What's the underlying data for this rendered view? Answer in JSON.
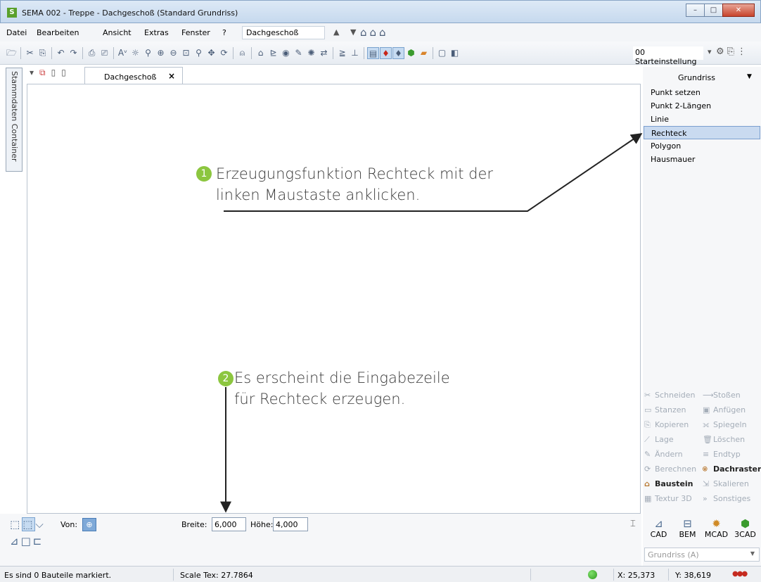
{
  "window": {
    "app_icon_letter": "S",
    "title": "SEMA  002 - Treppe  - Dachgeschoß (Standard Grundriss)",
    "minimize": "–",
    "maximize": "□",
    "close": "✕"
  },
  "menu": {
    "items": [
      "Datei",
      "Bearbeiten",
      "Ansicht",
      "Extras",
      "Fenster",
      "?"
    ],
    "mnemonics": [
      "D",
      "B",
      "A",
      "x",
      "F",
      "?"
    ],
    "layer_select": "Dachgeschoß",
    "nav_arrows": "▲ ▼"
  },
  "toolbar": {
    "preset_select": "00 Starteinstellung"
  },
  "side_tab": {
    "label": "Stammdaten Container"
  },
  "document": {
    "tab_label": "Dachgeschoß",
    "tab_close": "×"
  },
  "right_panel": {
    "title": "Grundriss",
    "title_arrow": "▼",
    "items": [
      "Punkt setzen",
      "Punkt 2-Längen",
      "Linie",
      "Rechteck",
      "Polygon",
      "Hausmauer"
    ],
    "selected_index": 3,
    "tools": [
      [
        "Schneiden",
        "Stoßen"
      ],
      [
        "Stanzen",
        "Anfügen"
      ],
      [
        "Kopieren",
        "Spiegeln"
      ],
      [
        "Lage",
        "Löschen"
      ],
      [
        "Ändern",
        "Endtyp"
      ],
      [
        "Berechnen",
        "Dachraster"
      ],
      [
        "Baustein",
        "Skalieren"
      ],
      [
        "Textur 3D",
        "Sonstiges"
      ]
    ],
    "modules": [
      "CAD",
      "BEM",
      "MCAD",
      "3CAD"
    ],
    "view_select": "Grundriss (A)"
  },
  "input_line": {
    "von_label": "Von:",
    "breite_label": "Breite:",
    "breite_value": "6,000",
    "hoehe_label": "Höhe:",
    "hoehe_value": "4,000"
  },
  "status": {
    "message": "Es sind 0 Bauteile markiert.",
    "scale": "Scale Tex: 27.7864",
    "x": "X: 25,373",
    "y": "Y: 38,619"
  },
  "annotations": [
    {
      "number": "1",
      "line1": "Erzeugungsfunktion Rechteck mit der",
      "line2": "linken Maustaste anklicken."
    },
    {
      "number": "2",
      "line1": "Es erscheint die Eingabezeile",
      "line2": "für Rechteck erzeugen."
    }
  ],
  "colors": {
    "badge": "#8cc63f",
    "selection": "#c9daf0",
    "close_button": "#c7442c"
  }
}
